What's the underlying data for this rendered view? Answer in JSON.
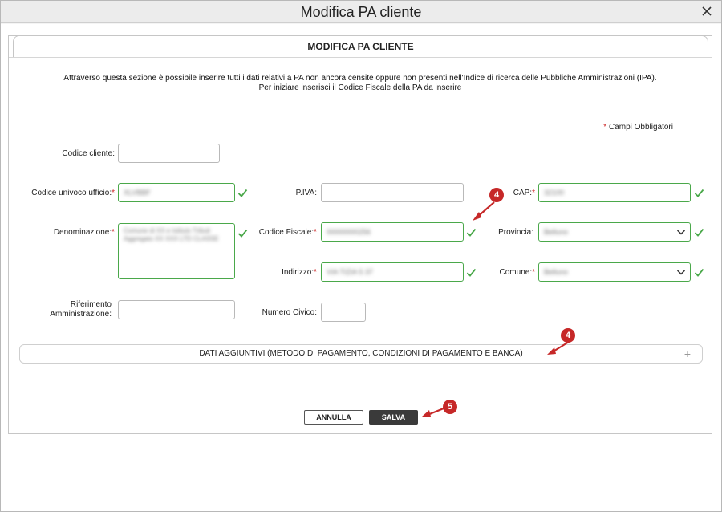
{
  "window": {
    "title": "Modifica PA cliente"
  },
  "panel": {
    "title": "MODIFICA PA CLIENTE",
    "intro_line1": "Attraverso questa sezione è possibile inserire tutti i dati relativi a PA non ancora censite oppure non presenti nell'Indice di ricerca delle Pubbliche Amministrazioni (IPA).",
    "intro_line2": "Per iniziare inserisci il Codice Fiscale della PA da inserire",
    "required_note": "Campi Obbligatori"
  },
  "fields": {
    "codice_cliente": {
      "label": "Codice cliente:",
      "value": ""
    },
    "codice_univoco": {
      "label": "Codice univoco ufficio:",
      "value": "XLVBBF"
    },
    "piva": {
      "label": "P.IVA:",
      "value": ""
    },
    "cap": {
      "label": "CAP:",
      "value": "32100"
    },
    "denominazione": {
      "label": "Denominazione:",
      "value": "Comune di XX e Istituto Tributi Aggregato XX XXX LTD CLASSE"
    },
    "codice_fiscale": {
      "label": "Codice Fiscale:",
      "value": "00000000256"
    },
    "provincia": {
      "label": "Provincia:",
      "value": "Belluno"
    },
    "indirizzo": {
      "label": "Indirizzo:",
      "value": "VIA TIZIA 5 37"
    },
    "comune": {
      "label": "Comune:",
      "value": "Belluno"
    },
    "riferimento_line1": "Riferimento",
    "riferimento_line2": "Amministrazione:",
    "riferimento": {
      "value": ""
    },
    "numero_civico": {
      "label": "Numero Civico:",
      "value": ""
    }
  },
  "accordion": {
    "label": "DATI AGGIUNTIVI (METODO DI PAGAMENTO, CONDIZIONI DI PAGAMENTO E BANCA)",
    "toggle": "+"
  },
  "buttons": {
    "cancel": "ANNULLA",
    "save": "SALVA"
  },
  "annotations": {
    "badge_a": "4",
    "badge_b": "4",
    "badge_c": "5"
  },
  "colors": {
    "valid": "#4aa84a",
    "required": "#cc1f1f",
    "annotation": "#c62828",
    "save_bg": "#3a3a3a"
  }
}
